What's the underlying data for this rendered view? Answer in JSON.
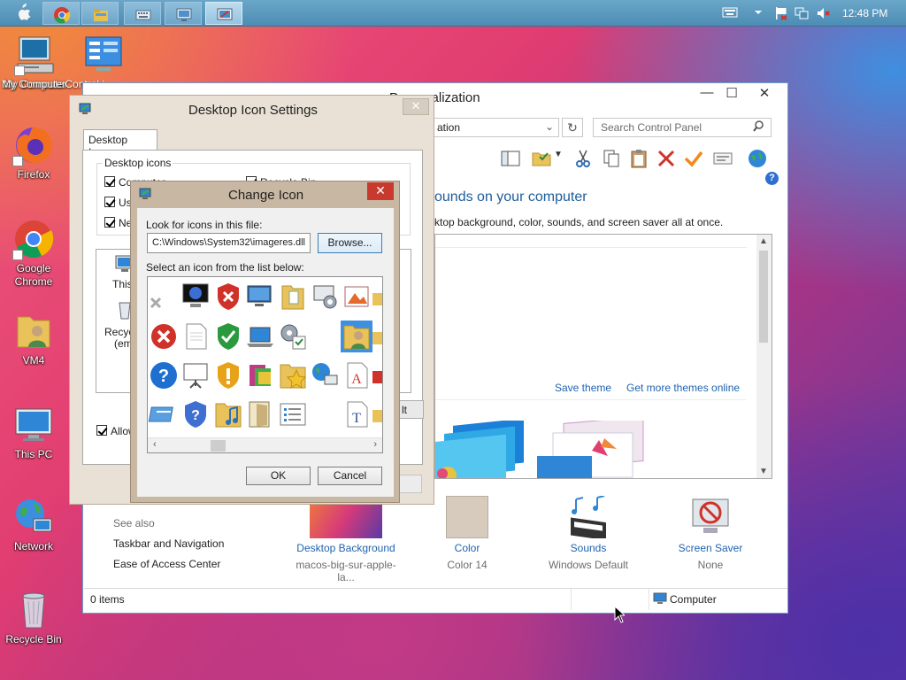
{
  "taskbar": {
    "time": "12:48 PM",
    "apps": [
      "chrome-icon",
      "file-explorer-icon",
      "on-screen-keyboard-icon",
      "remote-desktop-icon",
      "personalization-icon"
    ],
    "tray": [
      "keyboard-icon",
      "chevron-up-icon",
      "flag-icon",
      "network-icon",
      "volume-muted-icon"
    ]
  },
  "desktop": {
    "icons": [
      {
        "label": "My Computer",
        "icon": "computer-icon"
      },
      {
        "label": "Control Panel",
        "icon": "control-panel-icon"
      },
      {
        "label": "Firefox",
        "icon": "firefox-icon"
      },
      {
        "label": "Google Chrome",
        "icon": "chrome-icon"
      },
      {
        "label": "VM4",
        "icon": "user-folder-icon"
      },
      {
        "label": "This PC",
        "icon": "this-pc-icon"
      },
      {
        "label": "Network",
        "icon": "network-globe-icon"
      },
      {
        "label": "Recycle Bin",
        "icon": "recycle-bin-icon"
      }
    ]
  },
  "personalization": {
    "title": "Personalization",
    "address": "ation",
    "search_placeholder": "Search Control Panel",
    "heading": "ounds on your computer",
    "subheading": "ktop background, color, sounds, and screen saver all at once.",
    "save_theme": "Save theme",
    "get_more_themes": "Get more themes online",
    "see_also": "See also",
    "taskbar_nav": "Taskbar and Navigation",
    "ease_access": "Ease of Access Center",
    "bottom": [
      {
        "label": "Desktop Background",
        "sub": "macos-big-sur-apple-la..."
      },
      {
        "label": "Color",
        "sub": "Color 14"
      },
      {
        "label": "Sounds",
        "sub": "Windows Default"
      },
      {
        "label": "Screen Saver",
        "sub": "None"
      }
    ],
    "status_items": "0 items",
    "status_location": "Computer"
  },
  "desktop_icon_settings": {
    "title": "Desktop Icon Settings",
    "tab": "Desktop Icons",
    "group_label": "Desktop icons",
    "checkboxes": [
      {
        "label": "Computer",
        "checked": true
      },
      {
        "label": "Use",
        "checked": true
      },
      {
        "label": "Ne",
        "checked": true
      },
      {
        "label": "Recycle Bin",
        "checked": true
      }
    ],
    "list_items": [
      "This",
      "Recyc",
      "(em"
    ],
    "allow_label": "Allow",
    "right_button_fragment": "lt"
  },
  "change_icon": {
    "title": "Change Icon",
    "look_label": "Look for icons in this file:",
    "file_path": "C:\\Windows\\System32\\imageres.dll",
    "browse": "Browse...",
    "select_label": "Select an icon from the list below:",
    "ok": "OK",
    "cancel": "Cancel",
    "selected_icon": "user-folder-icon"
  },
  "colors": {
    "accent": "#1f64b0",
    "heading": "#1d5c9b",
    "close_red": "#c8392e",
    "selection": "#3d8fe0"
  }
}
